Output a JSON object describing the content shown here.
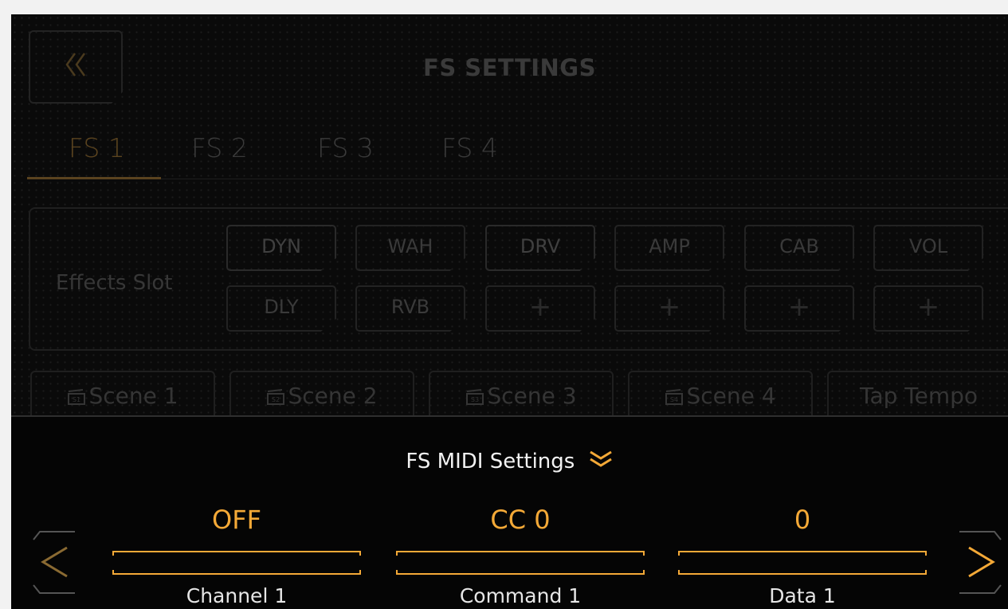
{
  "title": "FS SETTINGS",
  "back_icon": "double-chevron-left-icon",
  "tabs": [
    {
      "label": "FS 1",
      "active": true
    },
    {
      "label": "FS 2",
      "active": false
    },
    {
      "label": "FS 3",
      "active": false
    },
    {
      "label": "FS 4",
      "active": false
    }
  ],
  "effects": {
    "label": "Effects Slot",
    "row1": [
      "DYN",
      "WAH",
      "DRV",
      "AMP",
      "CAB",
      "VOL"
    ],
    "row2": [
      "DLY",
      "RVB",
      "+",
      "+",
      "+",
      "+"
    ]
  },
  "scenes": [
    {
      "label": "Scene 1",
      "icon": "S1"
    },
    {
      "label": "Scene 2",
      "icon": "S2"
    },
    {
      "label": "Scene 3",
      "icon": "S3"
    },
    {
      "label": "Scene 4",
      "icon": "S4"
    },
    {
      "label": "Tap Tempo",
      "icon": ""
    }
  ],
  "midi": {
    "title": "FS MIDI Settings",
    "collapse_icon": "double-chevron-down-icon",
    "params": [
      {
        "value": "OFF",
        "label": "Channel 1"
      },
      {
        "value": "CC 0",
        "label": "Command 1"
      },
      {
        "value": "0",
        "label": "Data 1"
      }
    ],
    "prev_icon": "chevron-left-icon",
    "next_icon": "chevron-right-icon"
  },
  "colors": {
    "accent": "#f4a937",
    "background": "#050505",
    "dimmed_text": "#3a3a3a"
  }
}
